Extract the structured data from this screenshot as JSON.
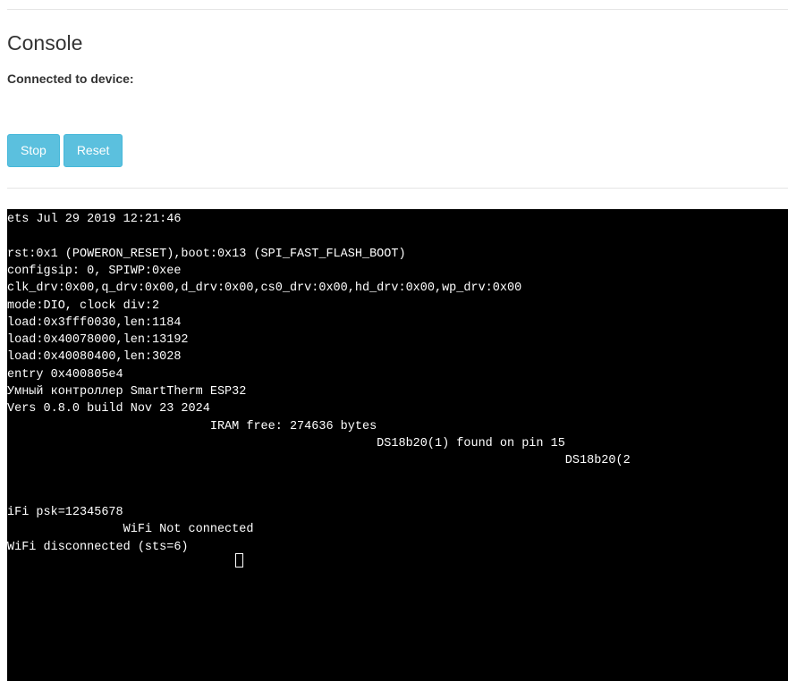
{
  "header": {
    "title": "Console",
    "connected_label": "Connected to device:",
    "device_name": ""
  },
  "controls": {
    "stop_label": "Stop",
    "reset_label": "Reset"
  },
  "terminal": {
    "lines": [
      "ets Jul 29 2019 12:21:46",
      "",
      "rst:0x1 (POWERON_RESET),boot:0x13 (SPI_FAST_FLASH_BOOT)",
      "configsip: 0, SPIWP:0xee",
      "clk_drv:0x00,q_drv:0x00,d_drv:0x00,cs0_drv:0x00,hd_drv:0x00,wp_drv:0x00",
      "mode:DIO, clock div:2",
      "load:0x3fff0030,len:1184",
      "load:0x40078000,len:13192",
      "load:0x40080400,len:3028",
      "entry 0x400805e4",
      "Умный контроллер SmartTherm ESP32",
      "Vers 0.8.0 build Nov 23 2024",
      "                            IRAM free: 274636 bytes",
      "                                                   DS18b20(1) found on pin 15",
      "                                                                             DS18b20(2",
      "",
      "",
      "iFi psk=12345678",
      "                WiFi Not connected",
      "WiFi disconnected (sts=6)"
    ]
  }
}
